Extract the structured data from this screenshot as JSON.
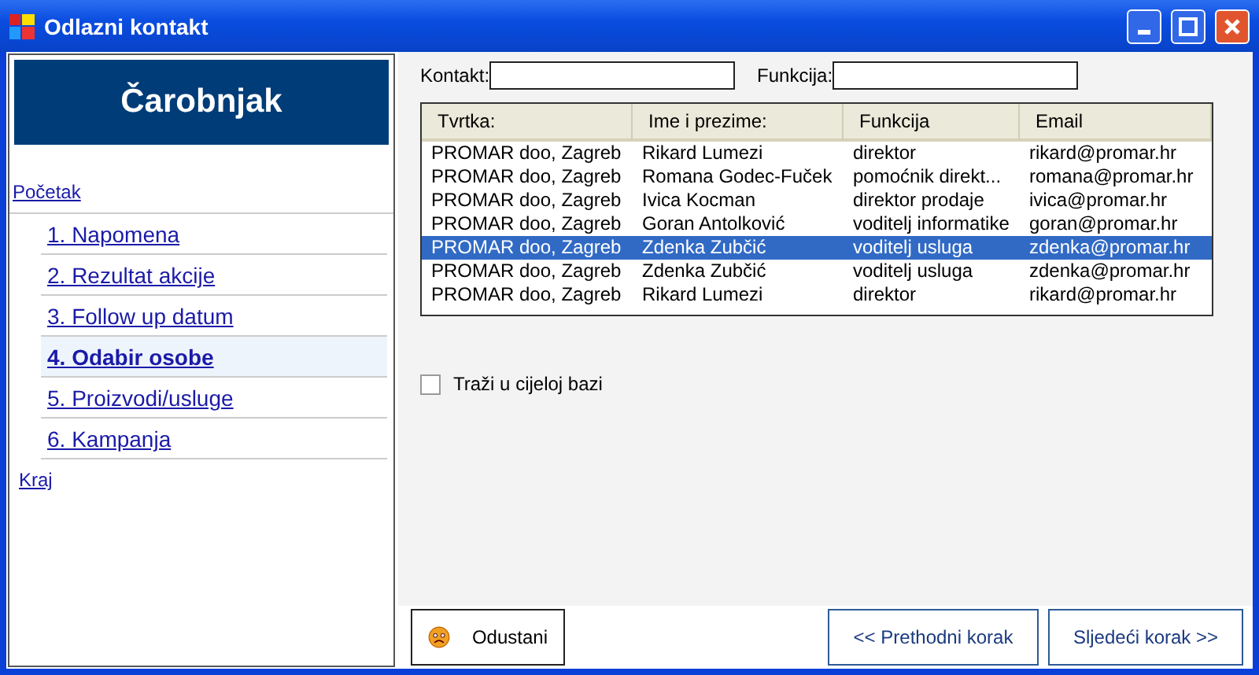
{
  "window": {
    "title": "Odlazni kontakt"
  },
  "sidebar": {
    "header": "Čarobnjak",
    "start_link": "Početak",
    "steps": [
      {
        "label": "1. Napomena",
        "selected": false
      },
      {
        "label": "2. Rezultat akcije",
        "selected": false
      },
      {
        "label": "3. Follow up datum",
        "selected": false
      },
      {
        "label": "4. Odabir osobe",
        "selected": true
      },
      {
        "label": "5. Proizvodi/usluge",
        "selected": false
      },
      {
        "label": "6. Kampanja",
        "selected": false
      }
    ],
    "end_link": "Kraj"
  },
  "filters": [
    {
      "label": "Kontakt:"
    },
    {
      "label": "Funkcija:"
    }
  ],
  "table": {
    "columns": [
      "Tvrtka:",
      "Ime i prezime:",
      "Funkcija",
      "Email"
    ],
    "rows": [
      {
        "cells": [
          "PROMAR doo, Zagreb",
          "Rikard Lumezi",
          "direktor",
          "rikard@promar.hr"
        ],
        "selected": false
      },
      {
        "cells": [
          "PROMAR doo, Zagreb",
          "Romana Godec-Fuček",
          "pomoćnik direkt...",
          "romana@promar.hr"
        ],
        "selected": false
      },
      {
        "cells": [
          "PROMAR doo, Zagreb",
          "Ivica Kocman",
          "direktor prodaje",
          "ivica@promar.hr"
        ],
        "selected": false
      },
      {
        "cells": [
          "PROMAR doo, Zagreb",
          "Goran Antolković",
          "voditelj informatike",
          "goran@promar.hr"
        ],
        "selected": false
      },
      {
        "cells": [
          "PROMAR doo, Zagreb",
          "Zdenka Zubčić",
          "voditelj usluga",
          "zdenka@promar.hr"
        ],
        "selected": true
      },
      {
        "cells": [
          "PROMAR doo, Zagreb",
          "Zdenka Zubčić",
          "voditelj usluga",
          "zdenka@promar.hr"
        ],
        "selected": false
      },
      {
        "cells": [
          "PROMAR doo, Zagreb",
          "Rikard Lumezi",
          "direktor",
          "rikard@promar.hr"
        ],
        "selected": false
      }
    ]
  },
  "search_all": {
    "label": "Traži u cijeloj bazi",
    "checked": false
  },
  "buttons": {
    "cancel": "Odustani",
    "previous": "<< Prethodni korak",
    "next": "Sljedeći korak >>"
  }
}
